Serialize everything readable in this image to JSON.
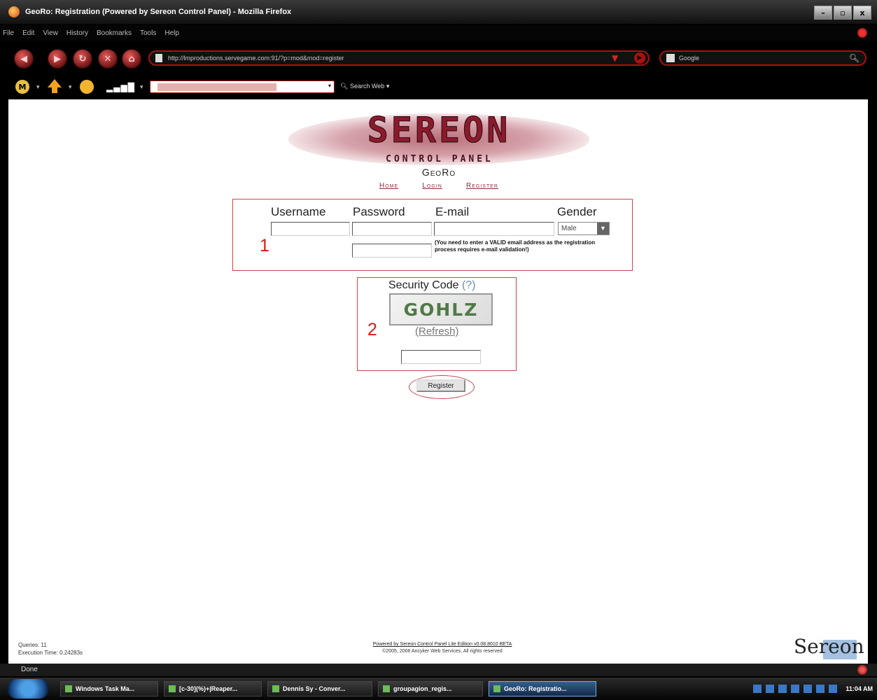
{
  "window": {
    "title": "GeoRo: Registration (Powered by Sereon Control Panel) - Mozilla Firefox",
    "buttons": {
      "minimize": "–",
      "maximize": "▫",
      "close": "x"
    }
  },
  "menu": [
    "File",
    "Edit",
    "View",
    "History",
    "Bookmarks",
    "Tools",
    "Help"
  ],
  "nav": {
    "url": "http://lmproductions.servegame.com:91/?p=mod&mod=register",
    "search_engine": "Google"
  },
  "toolbar": {
    "web_search_label": "Search Web"
  },
  "page": {
    "logo_main": "SEREON",
    "logo_sub": "CONTROL PANEL",
    "site_name": "GeoRo",
    "nav_links": [
      "Home",
      "Login",
      "Register"
    ],
    "form": {
      "username_label": "Username",
      "password_label": "Password",
      "email_label": "E-mail",
      "gender_label": "Gender",
      "gender_value": "Male",
      "email_note": "(You need to enter a VALID email address as the registration process requires e-mail validation!)"
    },
    "annotation_1": "1",
    "annotation_2": "2",
    "security": {
      "title": "Security Code",
      "help": "(?)",
      "captcha_text": "GOHLZ",
      "refresh": "(Refresh)"
    },
    "register_button": "Register",
    "stats": {
      "queries": "Queries: 11",
      "execution": "Execution Time: 0.24283s"
    },
    "footer": {
      "powered": "Powered by Sereon Control Panel Lite Edition v0.08.8010 BETA",
      "copyright": "©2005, 2006 Ancyker Web Services, All rights reserved"
    },
    "corner_logo": "Sereon"
  },
  "status": "Done",
  "taskbar": {
    "tasks": [
      "Windows Task Ma...",
      "[c-30](%)+|Reaper...",
      "Dennis Sy - Conver...",
      "groupagion_regis...",
      "GeoRo: Registratio..."
    ],
    "clock": "11:04 AM"
  }
}
